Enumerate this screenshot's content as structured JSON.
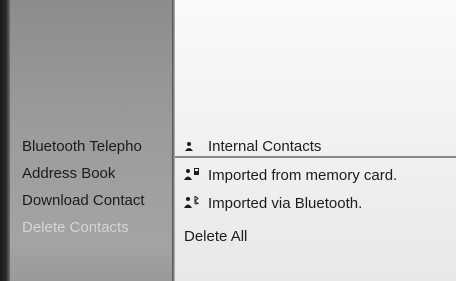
{
  "left_menu": {
    "items": [
      {
        "label": "Bluetooth Telepho",
        "state": "normal"
      },
      {
        "label": "Address Book",
        "state": "normal"
      },
      {
        "label": "Download Contact",
        "state": "normal"
      },
      {
        "label": "Delete Contacts",
        "state": "selected"
      }
    ]
  },
  "right_menu": {
    "items": [
      {
        "label": "Internal Contacts",
        "icon": "person-icon"
      },
      {
        "label": "Imported from memory card.",
        "icon": "memory-card-import-icon"
      },
      {
        "label": "Imported via Bluetooth.",
        "icon": "bluetooth-import-icon"
      },
      {
        "label": "Delete All",
        "icon": ""
      }
    ]
  }
}
